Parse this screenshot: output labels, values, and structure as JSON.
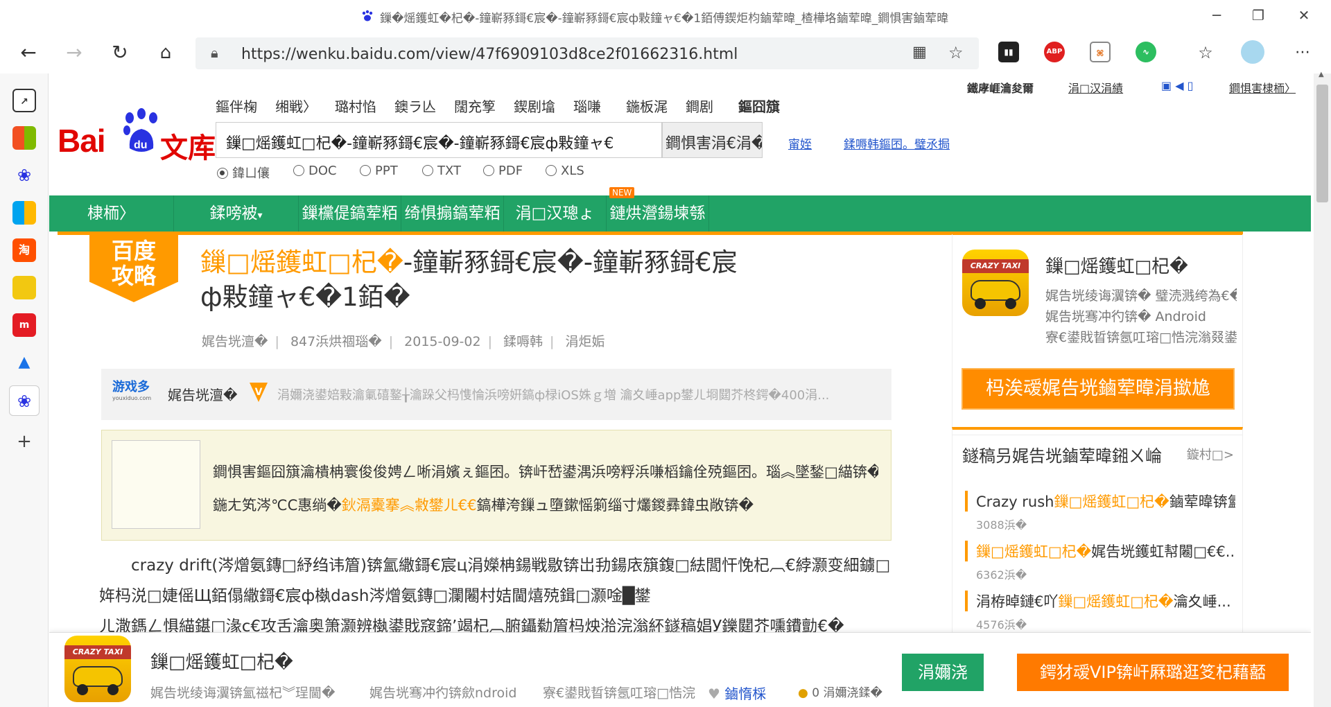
{
  "window": {
    "title": "鏁�熎鑊虹�杞�-鐘嶄豩鎶€宸�-鐘嶄豩鎶€宸ф敤鐘ャ€�1銆傅鍥炬枃鏀荤暐_楂樺垎鏀荤暐_鐧惧害鏀荤暐"
  },
  "browser": {
    "url": "https://wenku.baidu.com/view/47f6909103d8ce2f01662316.html",
    "abp_label": "ABP"
  },
  "site": {
    "logo_bai": "Bai",
    "logo_du": "du",
    "logo_wenku": "文库",
    "topnav": [
      "鏂伴椈",
      "缃戦〉",
      "璐村惂",
      "鐭ラ亾",
      "闊充箰",
      "鍥剧墖",
      "瑙嗛",
      "鍦板浘",
      "鐧剧",
      "鏂囧簱"
    ],
    "search_value": "鏁□熎鑊虹□杞�-鐘嶄豩鎶€宸�-鐘嶄豩鎶€宸ф敤鐘ャ€",
    "search_button": "鐧惧害涓€涓�",
    "links": [
      "甯姪",
      "鍒嗕韩鏂囨。璧氶挶"
    ],
    "filetypes": [
      "鍏ㄩ儴",
      "DOC",
      "PPT",
      "TXT",
      "PDF",
      "XLS"
    ],
    "util_user": "鐵庨崕瀹夋爾",
    "util_app": "涓□汉涓績",
    "util_baidu": "鐧惧害棣栭〉"
  },
  "greennav": {
    "items": [
      "棣栭〉",
      "鍒嗙被",
      "鏁欓偍鎬荤粨",
      "绮惧搧鎬荤粨",
      "涓□汉璁ょ",
      "鏈烘瀯鍚堜綔"
    ],
    "new_tag": "NEW"
  },
  "article": {
    "badge": "百度\n攻略",
    "title_hl": "鏁□熎鑊虹□杞�",
    "title_rest": "-鐘嶄豩鎶€宸�-鐘嶄豩鎶€宸ф敤鐘ャ€�1銆�",
    "meta": [
      "娓告垙澶�",
      "847浜烘祻瑙�",
      "2015-09-02",
      "鍒嗕韩",
      "涓炬姤"
    ],
    "source_name": "娓告垙澶�",
    "source_logo": "游戏多",
    "source_logo_sub": "youxiduo.com",
    "source_desc": "涓嬭浇鍙婄敤瀹氭礂鐜╁瀹跺父杩愯惀浜嗙姸鎬ф椂iOS姝ｇ増 瀹夊崜app鐢ㄦ埛閮芥柊鍔�400涓...",
    "notice_line1": "鐧惧害鏂囧簱瀹樻柟寰俊俊娉ㄥ唽涓嬪ぇ鏂囨。锛屽嵆鍙湡浜嗙粰浜嗛槄鑰佺殑鏂囨。瑙︽墜鍫□緢锛�",
    "notice_line2_a": "鍦ㄤ笂涔℃C惠绱�",
    "notice_line2_hl": "鈥滆櫜搴︽敹鐢ㄦ€€",
    "notice_line2_b": "鎬樺洿鏁ュ墮鏉愮箣缁寸爜鍐彞鍏虫敞锛�",
    "body_p1": "crazy drift(涔熷氨鏄□紓绉讳篃)锛氳繖鎶€宸ц涓嬫柟鍚戦敭锛岀劧鍚庡簱鍑□紶閭忓悗杞︹€綍灏变細鐪□姩杩涚□婕傜Щ銆傝繖鎶€宸ф槸dash涔熷氨鏄□瀾闂村姞閫熺殑鍓□灏唫█鐢",
    "body_p2": "ㄦ潵鎷ㄥ惧緢鍖□湪c€攻舌瀹奥箫灏辨槸鍙戝窛鍗’竭杞︹腑鑷勬篃杩炴湁浣滃紑鐩稿娼У鑠閮芥嚑鐨勯€�"
  },
  "sidecard": {
    "app_name": "鏁□熎鑊虹□杞�",
    "app_icon_text": "CRAZY TAXI",
    "line1": "娓告垙绫诲瀷锛� 璧涜溅绔為€�",
    "line2": "娓告垙骞冲彴锛� Android",
    "line3": "寮€鍙戝晢锛氬叿瑢□悎浣滃叕鍙...",
    "download_btn": "杩涘叆娓告垙鏀荤暐涓撳尯"
  },
  "related": {
    "heading": "鐩稿叧娓告垙鏀荤暐鎺ㄨ崘",
    "more": "鏇村□>",
    "items": [
      {
        "pre": "Crazy rush",
        "hl": "鏁□熎鑊虹□杞�",
        "post": "鏀荤暐锛氳...",
        "count": "3088浜�"
      },
      {
        "pre": "",
        "hl": "鏁□熎鑊虹□杞�",
        "post": "娓告垙鑊虹幇闂□€€...",
        "count": "6362浜�"
      },
      {
        "pre": "涓栫晫鏈€吖",
        "hl": "鏁□熎鑊虹□杞�",
        "post": "瀹夊崜...",
        "count": "4576浜�"
      }
    ]
  },
  "bottombar": {
    "app_name": "鏁□熎鑊虹□杞�",
    "sub1": "娓告垙绫诲瀷锛氳禌杞︾珵閫�",
    "sub2": "娓告垙骞冲彴锛歛ndroid",
    "sub3": "寮€鍙戝晢锛氬叿瑢□悎浣滃叕鍙...",
    "fav": "鏀惰棌",
    "coin": "0 涓嬭浇鍒�",
    "download": "涓嬭浇",
    "vip": "鍔犲叆VIP锛屽厤璐逛笅杞藉嚭"
  },
  "colors": {
    "brand_red": "#e10602",
    "nav_green": "#21a366",
    "accent_orange": "#ff9a00",
    "link_blue": "#2255cc"
  }
}
